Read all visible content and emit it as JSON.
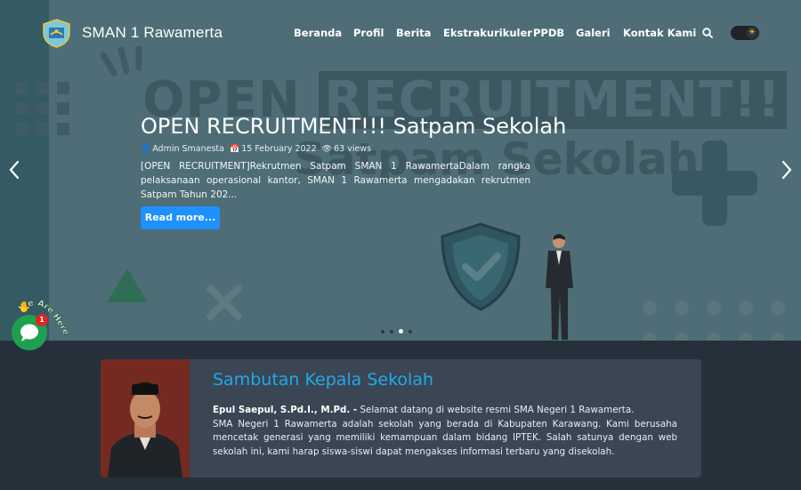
{
  "nav": {
    "brand": "SMAN 1 Rawamerta",
    "menu": [
      "Beranda",
      "Profil",
      "Berita",
      "Ekstrakurikuler",
      "PPDB",
      "Galeri",
      "Kontak Kami"
    ],
    "search_icon": "search-icon",
    "theme_toggle_icon": "sun-icon"
  },
  "hero": {
    "background_text_line1_a": "OPEN",
    "background_text_line1_b": "RECRUITMENT!!",
    "background_text_line2": "Satpam Sekolah",
    "title": "OPEN RECRUITMENT!!! Satpam Sekolah",
    "author": "Admin Smanesta",
    "date": "15 February 2022",
    "views": "63 views",
    "excerpt": "[OPEN RECRUITMENT]Rekrutmen Satpam SMAN 1 RawamertaDalam rangka pelaksanaan operasional kantor, SMAN 1 Rawamerta mengadakan rekrutmen Satpam Tahun 202...",
    "read_more": "Read more...",
    "active_slide": 3,
    "slide_count": 4
  },
  "chat": {
    "label": "We Are Here!",
    "badge": "1"
  },
  "welcome": {
    "title": "Sambutan Kepala Sekolah",
    "name": "Epul Saepul, S.Pd.I., M.Pd. -",
    "greeting": " Selamat datang di website resmi SMA Negeri 1 Rawamerta.",
    "body": "SMA Negeri 1 Rawamerta adalah sekolah yang berada di Kabupaten Karawang. Kami berusaha mencetak generasi yang memiliki kemampuan dalam bidang IPTEK. Salah satunya dengan web sekolah ini, kami harap siswa-siswi dapat mengakses informasi terbaru yang disekolah."
  },
  "colors": {
    "accent": "#1e90ff",
    "title_blue": "#1fa9ee",
    "hero_bg": "#4e6d76",
    "page_bg": "#25303b",
    "card_bg": "#3a4653",
    "chat_green": "#1fa04e"
  }
}
